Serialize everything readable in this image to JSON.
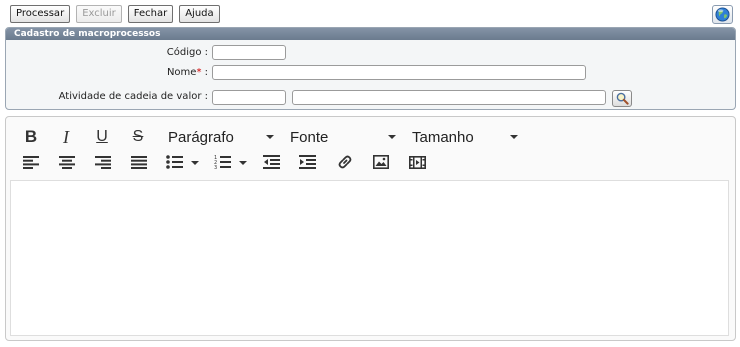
{
  "toolbar": {
    "process_label": "Processar",
    "delete_label": "Excluir",
    "close_label": "Fechar",
    "help_label": "Ajuda"
  },
  "panel": {
    "title": "Cadastro de macroprocessos",
    "code_label": "Código :",
    "name_label": "Nome",
    "name_required": "*",
    "name_suffix": " :",
    "activity_label": "Atividade de cadeia de valor :",
    "code_value": "",
    "name_value": "",
    "activity_code_value": "",
    "activity_desc_value": ""
  },
  "editor": {
    "bold": "B",
    "italic": "I",
    "underline": "U",
    "strike": "S",
    "paragraph": "Parágrafo",
    "font": "Fonte",
    "size": "Tamanho",
    "content": ""
  },
  "icons": {
    "globe": "globe-icon",
    "lookup": "magnifier-icon"
  },
  "colors": {
    "panel_header": "#6b7b8e",
    "required": "#d00000"
  }
}
